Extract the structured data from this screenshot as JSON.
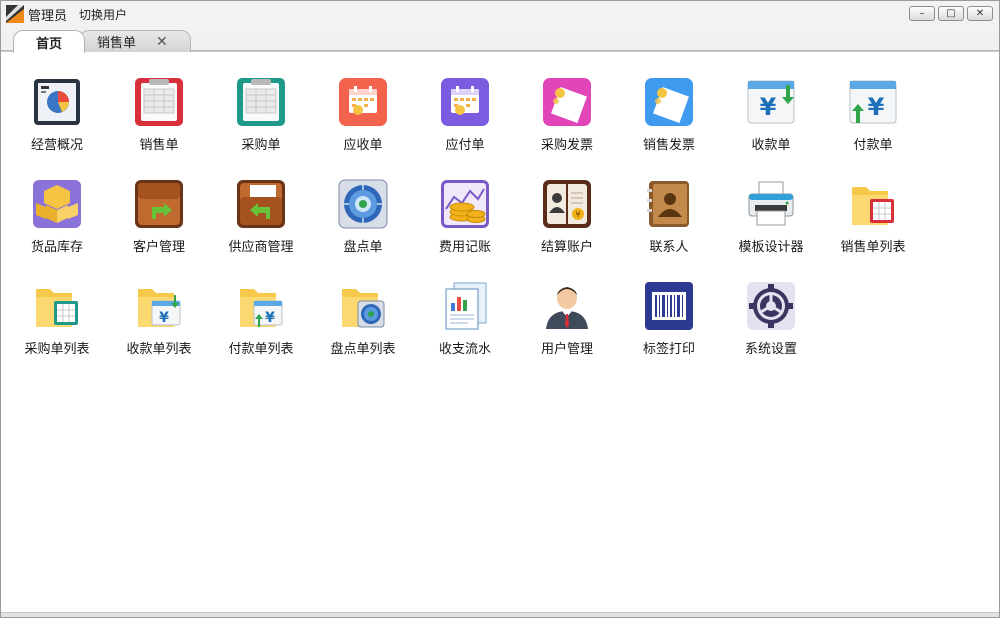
{
  "titlebar": {
    "user": "管理员",
    "switch_user": "切换用户",
    "minimize": "–",
    "maximize": "□",
    "close": "✕"
  },
  "tabs": [
    {
      "label": "首页",
      "active": true
    },
    {
      "label": "销售单",
      "active": false,
      "close": "✕"
    }
  ],
  "tiles": [
    {
      "label": "经营概况",
      "icon": "dashboard-chart-icon"
    },
    {
      "label": "销售单",
      "icon": "sales-order-icon"
    },
    {
      "label": "采购单",
      "icon": "purchase-order-icon"
    },
    {
      "label": "应收单",
      "icon": "receivable-calendar-icon"
    },
    {
      "label": "应付单",
      "icon": "payable-calendar-icon"
    },
    {
      "label": "采购发票",
      "icon": "purchase-invoice-icon"
    },
    {
      "label": "销售发票",
      "icon": "sales-invoice-icon"
    },
    {
      "label": "收款单",
      "icon": "receipt-yen-icon"
    },
    {
      "label": "付款单",
      "icon": "payment-yen-icon"
    },
    {
      "label": "货品库存",
      "icon": "inventory-boxes-icon"
    },
    {
      "label": "客户管理",
      "icon": "customer-folder-icon"
    },
    {
      "label": "供应商管理",
      "icon": "supplier-folder-icon"
    },
    {
      "label": "盘点单",
      "icon": "stocktake-disc-icon"
    },
    {
      "label": "费用记账",
      "icon": "expense-coins-icon"
    },
    {
      "label": "结算账户",
      "icon": "settlement-book-icon"
    },
    {
      "label": "联系人",
      "icon": "contacts-book-icon"
    },
    {
      "label": "模板设计器",
      "icon": "printer-icon"
    },
    {
      "label": "销售单列表",
      "icon": "sales-list-folder-icon"
    },
    {
      "label": "采购单列表",
      "icon": "purchase-list-folder-icon"
    },
    {
      "label": "收款单列表",
      "icon": "receipt-list-folder-icon"
    },
    {
      "label": "付款单列表",
      "icon": "payment-list-folder-icon"
    },
    {
      "label": "盘点单列表",
      "icon": "stocktake-list-folder-icon"
    },
    {
      "label": "收支流水",
      "icon": "cashflow-report-icon"
    },
    {
      "label": "用户管理",
      "icon": "user-avatar-icon"
    },
    {
      "label": "标签打印",
      "icon": "barcode-icon"
    },
    {
      "label": "系统设置",
      "icon": "settings-gear-icon"
    }
  ]
}
